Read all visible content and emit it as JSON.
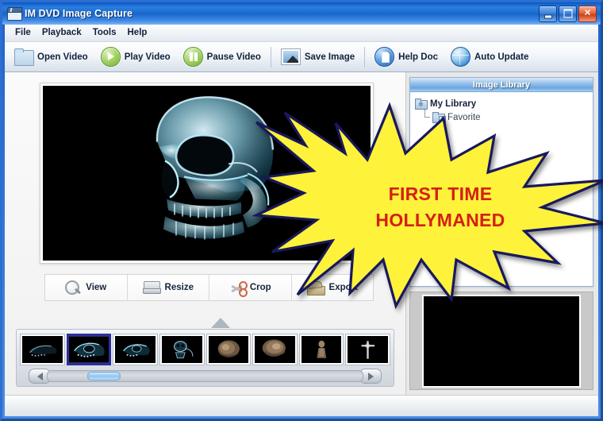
{
  "window": {
    "title": "IM DVD Image Capture",
    "icon": "film-clapper-icon",
    "controls": {
      "minimize": "–",
      "maximize": "□",
      "close": "✕"
    }
  },
  "menu": {
    "items": [
      {
        "label": "File"
      },
      {
        "label": "Playback"
      },
      {
        "label": "Tools"
      },
      {
        "label": "Help"
      }
    ]
  },
  "toolbar": {
    "buttons": [
      {
        "label": "Open Video",
        "icon": "folder-icon"
      },
      {
        "label": "Play Video",
        "icon": "play-icon"
      },
      {
        "label": "Pause Video",
        "icon": "pause-icon"
      },
      {
        "label": "Save Image",
        "icon": "picture-icon"
      },
      {
        "label": "Help Doc",
        "icon": "document-help-icon"
      },
      {
        "label": "Auto Update",
        "icon": "globe-icon"
      }
    ]
  },
  "preview": {
    "image_alt": "x-ray-skull-frame"
  },
  "actions": {
    "buttons": [
      {
        "label": "View",
        "icon": "magnifier-icon"
      },
      {
        "label": "Resize",
        "icon": "scanner-icon"
      },
      {
        "label": "Crop",
        "icon": "scissors-icon"
      },
      {
        "label": "Export",
        "icon": "export-box-icon"
      }
    ]
  },
  "filmstrip": {
    "thumbnails": [
      {
        "name": "thumb-1",
        "selected": false,
        "kind": "skull-dark"
      },
      {
        "name": "thumb-2",
        "selected": true,
        "kind": "skull-blue"
      },
      {
        "name": "thumb-3",
        "selected": false,
        "kind": "skull-blue"
      },
      {
        "name": "thumb-4",
        "selected": false,
        "kind": "skull-small"
      },
      {
        "name": "thumb-5",
        "selected": false,
        "kind": "head-brown"
      },
      {
        "name": "thumb-6",
        "selected": false,
        "kind": "head-brown"
      },
      {
        "name": "thumb-7",
        "selected": false,
        "kind": "figure"
      },
      {
        "name": "thumb-8",
        "selected": false,
        "kind": "cross"
      }
    ],
    "scrollbar": {
      "left_arrow": "◀",
      "right_arrow": "▶"
    }
  },
  "library": {
    "title": "Image Library",
    "tree": [
      {
        "label": "My Library",
        "icon": "folder-star-icon",
        "level": 0
      },
      {
        "label": "Favorite",
        "icon": "folder-plus-icon",
        "level": 1
      }
    ]
  },
  "callout": {
    "line1": "FIRST TIME",
    "line2": "HOLLYMANED",
    "fill_color": "#FFF23A",
    "stroke_color": "#18195c",
    "text_color": "#d41f15"
  }
}
